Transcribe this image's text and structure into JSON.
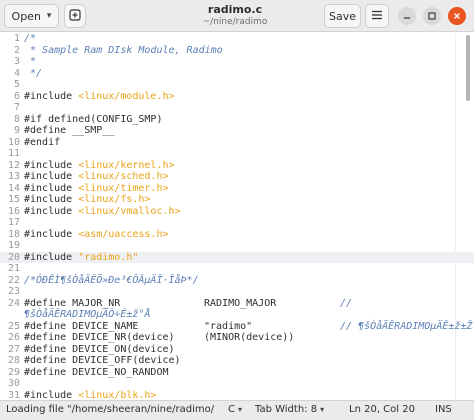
{
  "header": {
    "open_label": "Open",
    "title": "radimo.c",
    "subtitle": "~/nine/radimo",
    "save_label": "Save"
  },
  "editor": {
    "lines": [
      {
        "n": "1",
        "parts": [
          {
            "t": "/*",
            "c": "comment"
          }
        ]
      },
      {
        "n": "2",
        "parts": [
          {
            "t": " * Sample Ram DIsk Module, Radimo",
            "c": "comment"
          }
        ]
      },
      {
        "n": "3",
        "parts": [
          {
            "t": " *",
            "c": "comment"
          }
        ]
      },
      {
        "n": "4",
        "parts": [
          {
            "t": " */",
            "c": "comment"
          }
        ]
      },
      {
        "n": "5",
        "parts": []
      },
      {
        "n": "6",
        "parts": [
          {
            "t": "#include ",
            "c": ""
          },
          {
            "t": "<linux/module.h>",
            "c": "incpath"
          }
        ]
      },
      {
        "n": "7",
        "parts": []
      },
      {
        "n": "8",
        "parts": [
          {
            "t": "#if defined(CONFIG_SMP)",
            "c": ""
          }
        ]
      },
      {
        "n": "9",
        "parts": [
          {
            "t": "#define __SMP__",
            "c": ""
          }
        ]
      },
      {
        "n": "10",
        "parts": [
          {
            "t": "#endif",
            "c": ""
          }
        ]
      },
      {
        "n": "11",
        "parts": []
      },
      {
        "n": "12",
        "parts": [
          {
            "t": "#include ",
            "c": ""
          },
          {
            "t": "<linux/kernel.h>",
            "c": "incpath"
          }
        ]
      },
      {
        "n": "13",
        "parts": [
          {
            "t": "#include ",
            "c": ""
          },
          {
            "t": "<linux/sched.h>",
            "c": "incpath"
          }
        ]
      },
      {
        "n": "14",
        "parts": [
          {
            "t": "#include ",
            "c": ""
          },
          {
            "t": "<linux/timer.h>",
            "c": "incpath"
          }
        ]
      },
      {
        "n": "15",
        "parts": [
          {
            "t": "#include ",
            "c": ""
          },
          {
            "t": "<linux/fs.h>",
            "c": "incpath"
          }
        ]
      },
      {
        "n": "16",
        "parts": [
          {
            "t": "#include ",
            "c": ""
          },
          {
            "t": "<linux/vmalloc.h>",
            "c": "incpath"
          }
        ]
      },
      {
        "n": "17",
        "parts": []
      },
      {
        "n": "18",
        "parts": [
          {
            "t": "#include ",
            "c": ""
          },
          {
            "t": "<asm/uaccess.h>",
            "c": "incpath"
          }
        ]
      },
      {
        "n": "19",
        "parts": []
      },
      {
        "n": "20",
        "current": true,
        "parts": [
          {
            "t": "#include ",
            "c": ""
          },
          {
            "t": "\"radimo.h\"",
            "c": "incpath"
          }
        ]
      },
      {
        "n": "21",
        "parts": []
      },
      {
        "n": "22",
        "parts": [
          {
            "t": "/*ÓÐÊÌ¶šÒåÄÊÖ»Ðe³€ÔÂµÄÎ·ÎåÞ*/",
            "c": "comment"
          }
        ]
      },
      {
        "n": "23",
        "parts": []
      },
      {
        "n": "24",
        "parts": [
          {
            "t": "#define MAJOR_NR",
            "c": ""
          }
        ],
        "col2": "RADIMO_MAJOR",
        "col3": "//"
      },
      {
        "n": "",
        "parts": [
          {
            "t": "¶šÒåÄÊRADIMOµÄÖ÷É±ž°Å",
            "c": "comment"
          }
        ]
      },
      {
        "n": "25",
        "parts": [
          {
            "t": "#define DEVICE_NAME",
            "c": ""
          }
        ],
        "col2": "\"radimo\"",
        "col3": "// ¶šÒåÄÊRADIMOµÄÊ±ž±Ž",
        "col3c": "comment"
      },
      {
        "n": "26",
        "parts": [
          {
            "t": "#define DEVICE_NR(device)",
            "c": ""
          }
        ],
        "col2": "(MINOR(device))"
      },
      {
        "n": "27",
        "parts": [
          {
            "t": "#define DEVICE_ON(device)",
            "c": ""
          }
        ]
      },
      {
        "n": "28",
        "parts": [
          {
            "t": "#define DEVICE_OFF(device)",
            "c": ""
          }
        ]
      },
      {
        "n": "29",
        "parts": [
          {
            "t": "#define DEVICE_NO_RANDOM",
            "c": ""
          }
        ]
      },
      {
        "n": "30",
        "parts": []
      },
      {
        "n": "31",
        "parts": [
          {
            "t": "#include ",
            "c": ""
          },
          {
            "t": "<linux/blk.h>",
            "c": "incpath"
          }
        ]
      }
    ]
  },
  "statusbar": {
    "message": "Loading file \"/home/sheeran/nine/radimo/radi…",
    "language": "C",
    "tab_width": "Tab Width: 8",
    "position": "Ln 20, Col 20",
    "mode": "INS"
  },
  "icons": {
    "open_caret": "chevron-down-icon",
    "new_tab": "new-tab-icon",
    "menu": "hamburger-menu-icon",
    "minimize": "minimize-icon",
    "maximize": "maximize-icon",
    "close": "close-icon"
  },
  "colors": {
    "comment": "#5a7fb5",
    "include_path": "#e8a317",
    "close_button": "#e95420"
  }
}
